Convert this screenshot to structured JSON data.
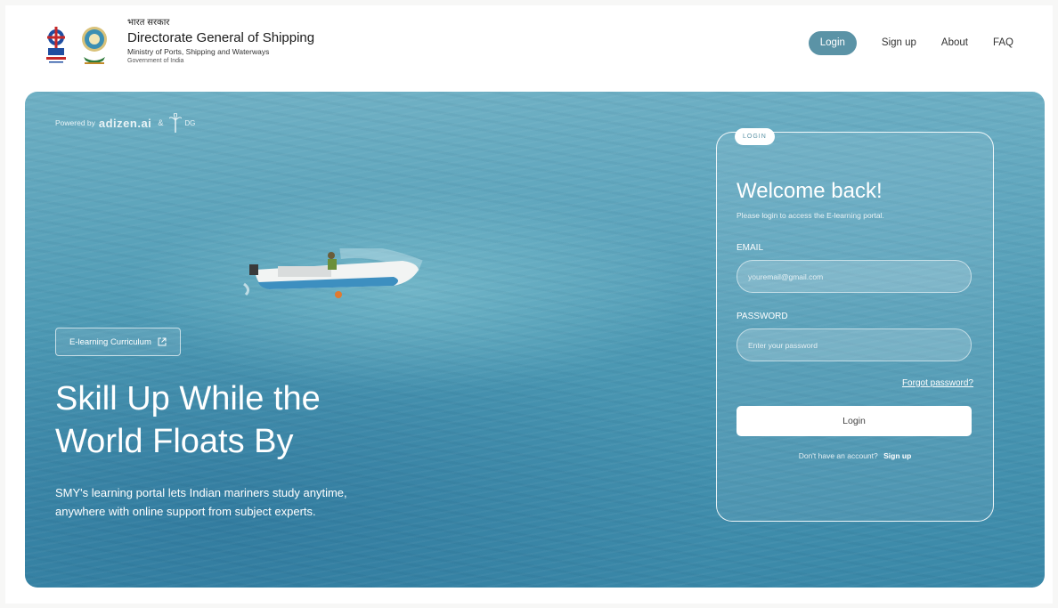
{
  "header": {
    "hindi_label": "भारत सरकार",
    "title": "Directorate General of Shipping",
    "ministry": "Ministry of Ports, Shipping and Waterways",
    "government": "Government of India"
  },
  "nav": {
    "login": "Login",
    "signup": "Sign up",
    "about": "About",
    "faq": "FAQ"
  },
  "hero": {
    "powered_by": "Powered by",
    "partner1": "adizen.ai",
    "amp": "&",
    "partner2": "DG",
    "curriculum_button": "E-learning Curriculum",
    "headline_line1": "Skill Up While the",
    "headline_line2": "World Floats By",
    "description": "SMY's learning portal lets Indian mariners study anytime, anywhere with online support from subject experts."
  },
  "login_card": {
    "tag": "LOGIN",
    "heading": "Welcome back!",
    "subheading": "Please login to access the E-learning portal.",
    "email_label": "EMAIL",
    "email_placeholder": "youremail@gmail.com",
    "password_label": "PASSWORD",
    "password_placeholder": "Enter your password",
    "forgot": "Forgot password?",
    "submit": "Login",
    "no_account": "Don't have an account?",
    "signup_link": "Sign up"
  },
  "colors": {
    "accent": "#5b93a6",
    "sea": "#4f9bb5"
  },
  "icons": {
    "external_link": "external-link-icon",
    "emblem": "ship-emblem-icon",
    "seal": "dg-seal-icon"
  }
}
